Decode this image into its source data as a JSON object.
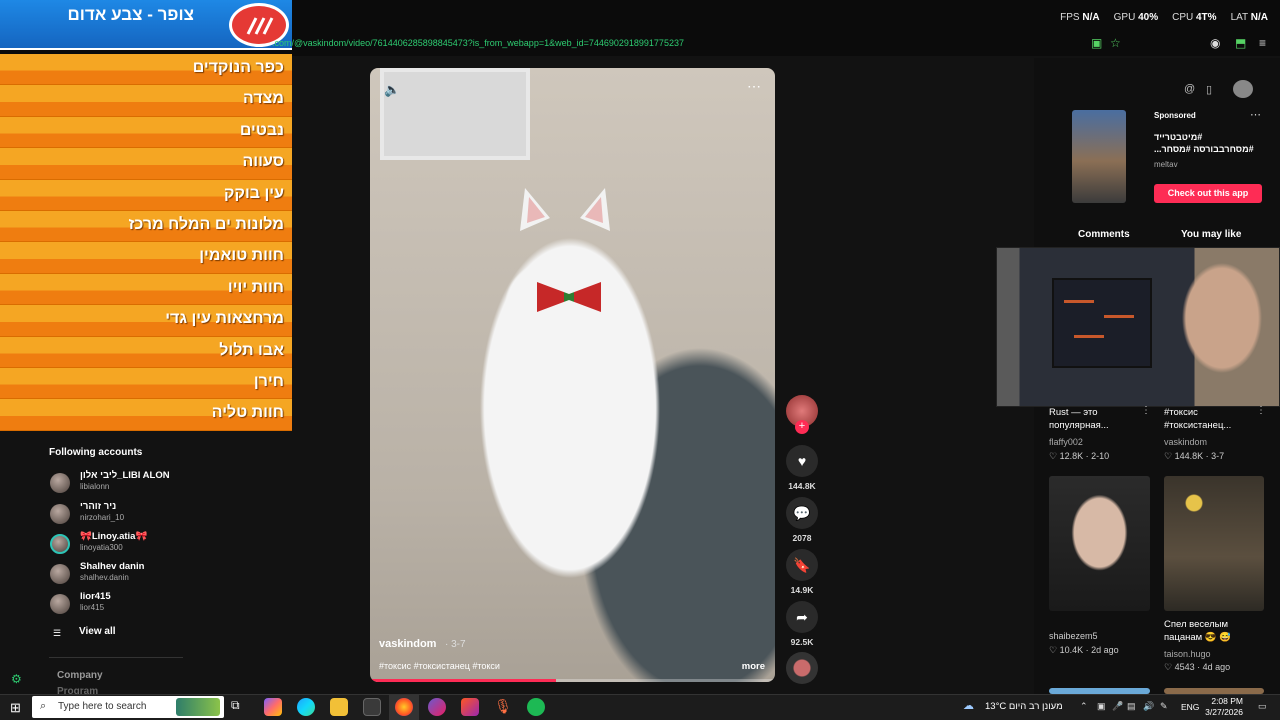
{
  "alert": {
    "title": "צופר - צבע אדום",
    "locations": [
      "כפר הנוקדים",
      "מצדה",
      "נבטים",
      "סעווה",
      "עין בוקק",
      "מלונות ים המלח מרכז",
      "חוות טואמין",
      "חוות יויו",
      "מרחצאות עין גדי",
      "אבו תלול",
      "חירן",
      "חוות טליה"
    ]
  },
  "url": ".com/@vaskindom/video/7614406285898845473?is_from_webapp=1&web_id=7446902918991775237",
  "stats": {
    "fps_label": "FPS",
    "fps": "N/A",
    "gpu_label": "GPU",
    "gpu": "40%",
    "cpu_label": "CPU",
    "cpu": "4T%",
    "lat_label": "LAT",
    "lat": "N/A"
  },
  "sidebar": {
    "following_title": "Following accounts",
    "accounts": [
      {
        "name": "ליבי אלון_LIBI ALON",
        "handle": "libialonn"
      },
      {
        "name": "ניר זוהרי",
        "handle": "nirzohari_10"
      },
      {
        "name": "🎀Linoy.atia🎀",
        "handle": "linoyatia300"
      },
      {
        "name": "Shalhev danin",
        "handle": "shalhev.danin"
      },
      {
        "name": "lior415",
        "handle": "lior415"
      }
    ],
    "view_all": "View all",
    "company": "Company",
    "program": "Program"
  },
  "video": {
    "author": "vaskindom",
    "date": "· 3-7",
    "tags": "#токсис #токсистанец #токси",
    "more": "more",
    "progress": 0.46
  },
  "actions": {
    "likes": "144.8K",
    "comments": "2078",
    "saves": "14.9K",
    "shares": "92.5K"
  },
  "sponsor": {
    "label": "Sponsored",
    "text": "#מיטבטרייד #מסחרבבורסה #מסחר...",
    "name": "meltav",
    "cta": "Check out this app"
  },
  "tabs": {
    "comments": "Comments",
    "you_may_like": "You may like"
  },
  "cards": [
    {
      "text": "Rust — это популярная...",
      "user": "flaffy002",
      "stats": "♡ 12.8K · 2-10"
    },
    {
      "text": "#токсис #токсистанец...",
      "user": "vaskindom",
      "stats": "♡ 144.8K · 3-7"
    },
    {
      "text": "",
      "user": "shaibezem5",
      "stats": "♡ 10.4K · 2d ago"
    },
    {
      "text": "Спел веселым пацанам 😎 😅",
      "user": "taison.hugo",
      "stats": "♡ 4543 · 4d ago"
    }
  ],
  "taskbar": {
    "search_placeholder": "Type here to search",
    "weather": "13°C מעונן רב היום",
    "lang": "ENG",
    "time": "2:08 PM",
    "date": "3/27/2026"
  },
  "colors": {
    "accent": "#fe2c55",
    "alert_orange": "#f5a623",
    "alert_blue": "#1e88e5",
    "url_green": "#2ecc71"
  }
}
